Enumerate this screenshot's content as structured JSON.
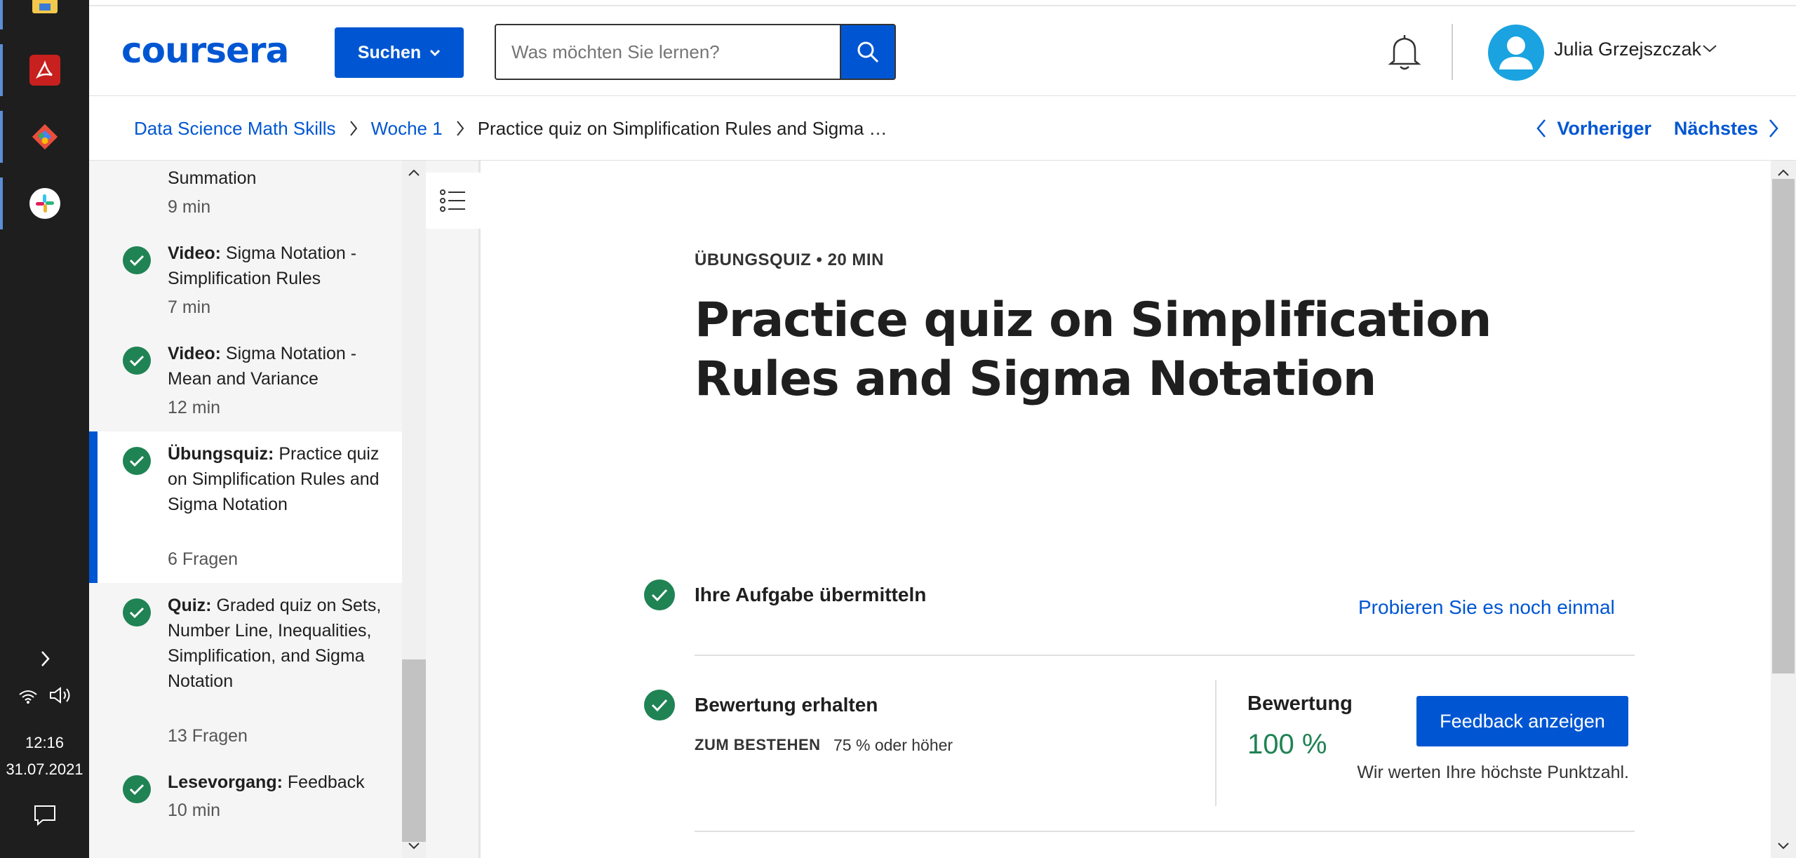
{
  "taskbar": {
    "clock_time": "12:16",
    "clock_date": "31.07.2021"
  },
  "header": {
    "logo": "coursera",
    "suchen_label": "Suchen",
    "search_placeholder": "Was möchten Sie lernen?",
    "user_name": "Julia Grzejszczak"
  },
  "breadcrumb": {
    "items": [
      "Data Science Math Skills",
      "Woche 1"
    ],
    "current": "Practice quiz on Simplification Rules and Sigma …",
    "prev_label": "Vorheriger",
    "next_label": "Nächstes"
  },
  "sidebar": {
    "items": [
      {
        "type": "",
        "title": "Summation",
        "meta": "9 min"
      },
      {
        "type": "Video:",
        "title": "Sigma Notation - Simplification Rules",
        "meta": "7 min"
      },
      {
        "type": "Video:",
        "title": "Sigma Notation - Mean and Variance",
        "meta": "12 min"
      },
      {
        "type": "Übungsquiz:",
        "title": "Practice quiz on Simplification Rules and Sigma Notation",
        "meta": "6 Fragen"
      },
      {
        "type": "Quiz:",
        "title": "Graded quiz on Sets, Number Line, Inequalities, Simplification, and Sigma Notation",
        "meta": "13 Fragen"
      },
      {
        "type": "Lesevorgang:",
        "title": "Feedback",
        "meta": "10 min"
      }
    ]
  },
  "main": {
    "kicker": "ÜBUNGSQUIZ • 20 MIN",
    "title": "Practice quiz on Simplification Rules and Sigma Notation",
    "submit_title": "Ihre Aufgabe übermitteln",
    "retry_label": "Probieren Sie es noch einmal",
    "grade_title": "Bewertung erhalten",
    "pass_label": "ZUM BESTEHEN",
    "pass_value": "75 % oder höher",
    "grade_label": "Bewertung",
    "grade_value": "100 %",
    "feedback_button": "Feedback anzeigen",
    "note": "Wir werten Ihre höchste Punktzahl."
  },
  "colors": {
    "brand": "#0056d2",
    "success": "#1f8354",
    "taskbar": "#1e1e1e"
  }
}
